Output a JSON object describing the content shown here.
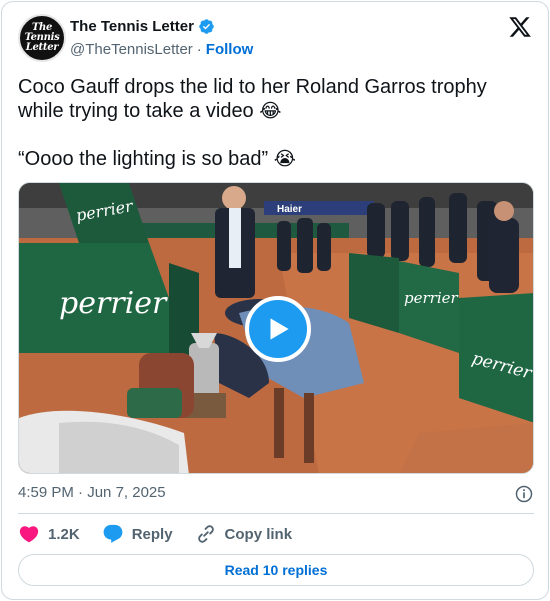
{
  "author": {
    "display_name": "The Tennis Letter",
    "handle": "@TheTennisLetter",
    "separator": "·",
    "follow_label": "Follow",
    "avatar_text": [
      "The",
      "Tennis",
      "Letter"
    ],
    "verified": true
  },
  "tweet": {
    "line1": "Coco Gauff drops the lid to her Roland Garros trophy while trying to take a video ",
    "emoji1": "😂",
    "line2": "“Oooo the lighting is so bad” ",
    "emoji2": "😭"
  },
  "media": {
    "type": "video",
    "signage": [
      "perrier",
      "Haier"
    ]
  },
  "meta": {
    "time": "4:59 PM",
    "separator": "·",
    "date": "Jun 7, 2025"
  },
  "actions": {
    "likes": "1.2K",
    "reply_label": "Reply",
    "copy_label": "Copy link"
  },
  "read_replies_label": "Read 10 replies",
  "colors": {
    "accent": "#1d9bf0",
    "link": "#006fd6",
    "like": "#f91880",
    "muted": "#536471",
    "clay": "#b4623c"
  },
  "icons": [
    "verified-badge-icon",
    "x-logo-icon",
    "play-icon",
    "info-icon",
    "heart-icon",
    "reply-bubble-icon",
    "link-icon"
  ]
}
